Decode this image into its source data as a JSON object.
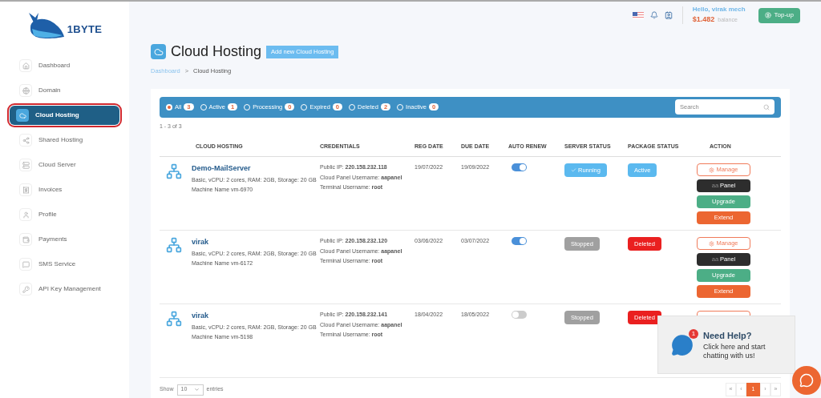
{
  "logo": {
    "text": "1BYTE"
  },
  "sidebar": {
    "items": [
      {
        "label": "Dashboard",
        "selected": false
      },
      {
        "label": "Domain",
        "selected": false
      },
      {
        "label": "Cloud Hosting",
        "selected": true
      },
      {
        "label": "Shared Hosting",
        "selected": false
      },
      {
        "label": "Cloud Server",
        "selected": false
      },
      {
        "label": "Invoices",
        "selected": false
      },
      {
        "label": "Profile",
        "selected": false
      },
      {
        "label": "Payments",
        "selected": false
      },
      {
        "label": "SMS Service",
        "selected": false
      },
      {
        "label": "API Key Management",
        "selected": false
      }
    ]
  },
  "topbar": {
    "greeting": "Hello, virak mech",
    "balance": "$1.482",
    "balance_label": "balance",
    "topup": "Top-up"
  },
  "page": {
    "title": "Cloud Hosting",
    "add_button": "Add new Cloud Hosting",
    "breadcrumb": [
      "Dashboard",
      ">",
      "Cloud Hosting"
    ]
  },
  "filters": [
    {
      "label": "All",
      "count": "3",
      "selected": true
    },
    {
      "label": "Active",
      "count": "1",
      "selected": false
    },
    {
      "label": "Processing",
      "count": "0",
      "selected": false
    },
    {
      "label": "Expired",
      "count": "0",
      "selected": false
    },
    {
      "label": "Deleted",
      "count": "2",
      "selected": false
    },
    {
      "label": "Inactive",
      "count": "0",
      "selected": false
    }
  ],
  "search": {
    "placeholder": "Search"
  },
  "range": "1 - 3 of 3",
  "table": {
    "columns": [
      "CLOUD HOSTING",
      "CREDENTIALS",
      "REG DATE",
      "DUE DATE",
      "AUTO RENEW",
      "SERVER STATUS",
      "PACKAGE STATUS",
      "ACTION"
    ],
    "rows": [
      {
        "name": "Demo-MailServer",
        "spec": "Basic, vCPU: 2 cores, RAM: 2GB, Storage: 20 GB",
        "machine": "Machine Name vm-6970",
        "ip": "Public IP: **220.158.232.118**",
        "panel_user": "Cloud Panel Username: **aapanel**",
        "terminal_user": "Terminal Username: **root**",
        "reg_date": "19/07/2022",
        "due_date": "19/09/2022",
        "auto_renew": true,
        "server_status": {
          "kind": "running",
          "label": "Running"
        },
        "package_status": {
          "kind": "active",
          "label": "Active"
        },
        "actions": [
          {
            "kind": "manage",
            "label": "Manage"
          },
          {
            "kind": "panel",
            "prefix": "aa",
            "label": "Panel"
          },
          {
            "kind": "upgrade",
            "label": "Upgrade"
          },
          {
            "kind": "extend",
            "label": "Extend"
          }
        ]
      },
      {
        "name": "virak",
        "spec": "Basic, vCPU: 2 cores, RAM: 2GB, Storage: 20 GB",
        "machine": "Machine Name vm-6172",
        "ip": "Public IP: **220.158.232.120**",
        "panel_user": "Cloud Panel Username: **aapanel**",
        "terminal_user": "Terminal Username: **root**",
        "reg_date": "03/06/2022",
        "due_date": "03/07/2022",
        "auto_renew": true,
        "server_status": {
          "kind": "stopped",
          "label": "Stopped"
        },
        "package_status": {
          "kind": "deleted",
          "label": "Deleted"
        },
        "actions": [
          {
            "kind": "manage",
            "label": "Manage"
          },
          {
            "kind": "panel",
            "prefix": "aa",
            "label": "Panel"
          },
          {
            "kind": "upgrade",
            "label": "Upgrade"
          },
          {
            "kind": "extend",
            "label": "Extend"
          }
        ]
      },
      {
        "name": "virak",
        "spec": "Basic, vCPU: 2 cores, RAM: 2GB, Storage: 20 GB",
        "machine": "Machine Name vm-5198",
        "ip": "Public IP: **220.158.232.141**",
        "panel_user": "Cloud Panel Username: **aapanel**",
        "terminal_user": "Terminal Username: **root**",
        "reg_date": "18/04/2022",
        "due_date": "18/05/2022",
        "auto_renew": false,
        "server_status": {
          "kind": "stopped",
          "label": "Stopped"
        },
        "package_status": {
          "kind": "deleted",
          "label": "Deleted"
        },
        "actions": [
          {
            "kind": "manage"
          }
        ]
      }
    ]
  },
  "footer": {
    "show": "Show",
    "page_size": "10",
    "entries": "entries",
    "pages": [
      {
        "label": "«",
        "selected": false
      },
      {
        "label": "‹",
        "selected": false
      },
      {
        "label": "1",
        "selected": true
      },
      {
        "label": "›",
        "selected": false
      },
      {
        "label": "»",
        "selected": false
      }
    ]
  },
  "help": {
    "title": "Need Help?",
    "text": "Click here and start chatting with us!",
    "badge": "1"
  }
}
